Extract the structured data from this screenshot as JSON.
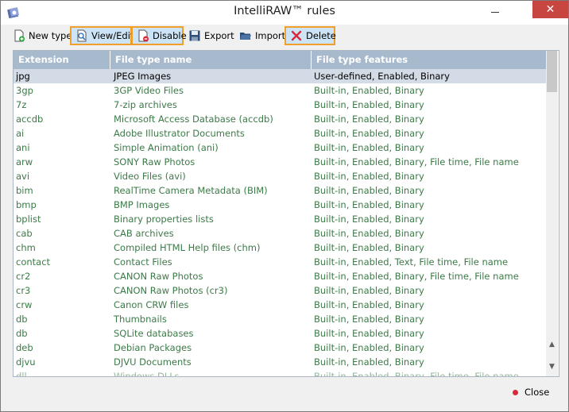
{
  "window": {
    "title": "IntelliRAW™ rules"
  },
  "toolbar": {
    "new_type": "New type",
    "view_edit": "View/Edit",
    "disable": "Disable",
    "export": "Export",
    "import": "Import",
    "delete": "Delete"
  },
  "columns": {
    "extension": "Extension",
    "file_type_name": "File type name",
    "file_type_features": "File type features"
  },
  "rows": [
    {
      "ext": "jpg",
      "name": "JPEG Images",
      "features": "User-defined, Enabled, Binary"
    },
    {
      "ext": "3gp",
      "name": "3GP Video Files",
      "features": "Built-in, Enabled, Binary"
    },
    {
      "ext": "7z",
      "name": "7-zip archives",
      "features": "Built-in, Enabled, Binary"
    },
    {
      "ext": "accdb",
      "name": "Microsoft Access Database (accdb)",
      "features": "Built-in, Enabled, Binary"
    },
    {
      "ext": "ai",
      "name": "Adobe Illustrator Documents",
      "features": "Built-in, Enabled, Binary"
    },
    {
      "ext": "ani",
      "name": "Simple Animation (ani)",
      "features": "Built-in, Enabled, Binary"
    },
    {
      "ext": "arw",
      "name": "SONY Raw Photos",
      "features": "Built-in, Enabled, Binary, File time, File name"
    },
    {
      "ext": "avi",
      "name": "Video Files (avi)",
      "features": "Built-in, Enabled, Binary"
    },
    {
      "ext": "bim",
      "name": "RealTime Camera Metadata (BIM)",
      "features": "Built-in, Enabled, Binary"
    },
    {
      "ext": "bmp",
      "name": "BMP Images",
      "features": "Built-in, Enabled, Binary"
    },
    {
      "ext": "bplist",
      "name": "Binary properties lists",
      "features": "Built-in, Enabled, Binary"
    },
    {
      "ext": "cab",
      "name": "CAB archives",
      "features": "Built-in, Enabled, Binary"
    },
    {
      "ext": "chm",
      "name": "Compiled HTML Help files (chm)",
      "features": "Built-in, Enabled, Binary"
    },
    {
      "ext": "contact",
      "name": "Contact Files",
      "features": "Built-in, Enabled, Text, File time, File name"
    },
    {
      "ext": "cr2",
      "name": "CANON Raw Photos",
      "features": "Built-in, Enabled, Binary, File time, File name"
    },
    {
      "ext": "cr3",
      "name": "CANON Raw Photos (cr3)",
      "features": "Built-in, Enabled, Binary"
    },
    {
      "ext": "crw",
      "name": "Canon CRW files",
      "features": "Built-in, Enabled, Binary"
    },
    {
      "ext": "db",
      "name": "Thumbnails",
      "features": "Built-in, Enabled, Binary"
    },
    {
      "ext": "db",
      "name": "SQLite databases",
      "features": "Built-in, Enabled, Binary"
    },
    {
      "ext": "deb",
      "name": "Debian Packages",
      "features": "Built-in, Enabled, Binary"
    },
    {
      "ext": "djvu",
      "name": "DJVU Documents",
      "features": "Built-in, Enabled, Binary"
    },
    {
      "ext": "dll",
      "name": "Windows DLLs",
      "features": "Built-in, Enabled, Binary, File time, File name"
    }
  ],
  "footer": {
    "close": "Close"
  },
  "colors": {
    "highlight_border": "#f0a028",
    "selected_row": "#d3dbe6",
    "header_bg": "#a7b9cc",
    "feature_text": "#3c7a48"
  }
}
